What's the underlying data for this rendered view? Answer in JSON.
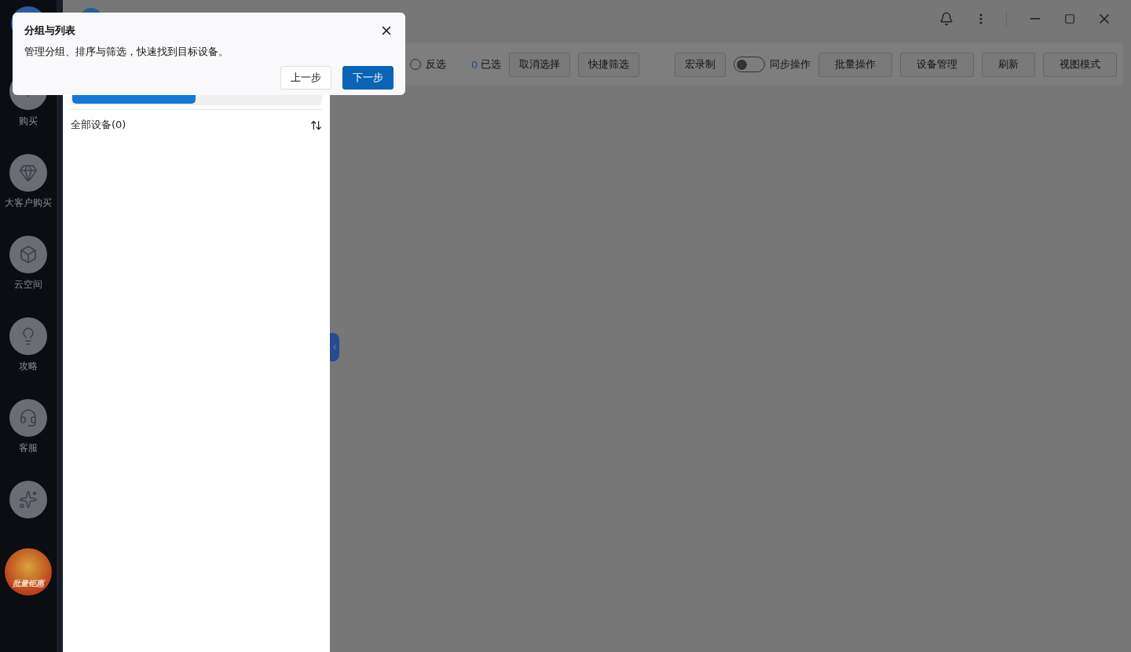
{
  "sidebar": {
    "items": [
      {
        "kind": "labeled",
        "label": "购买"
      },
      {
        "kind": "labeled",
        "label": "大客户购买"
      },
      {
        "kind": "labeled",
        "label": "云空间"
      },
      {
        "kind": "labeled",
        "label": "攻略"
      },
      {
        "kind": "labeled",
        "label": "客服"
      },
      {
        "kind": "icon_only"
      }
    ],
    "promo": {
      "label": "批量钜惠"
    }
  },
  "guide": {
    "title": "分组与列表",
    "text": "管理分组、排序与筛选，快速找到目标设备。",
    "buttons": [
      {
        "label": "上一步",
        "primary": false
      },
      {
        "label": "下一步",
        "primary": true
      }
    ]
  },
  "group_panel": {
    "tabs": [
      {
        "selected": true
      },
      {
        "selected": false
      }
    ],
    "group": "全部设备(0)"
  },
  "toolbar": {
    "invert": {
      "label": "反选",
      "checked": false
    },
    "selected_count": "0",
    "selected_label": "已选",
    "left_buttons": [
      "取消选择",
      "快捷筛选"
    ],
    "macro": "宏录制",
    "sync": {
      "label": "同步操作",
      "on": false
    },
    "right_buttons": [
      "批量操作",
      "设备管理",
      "刷新",
      "视图模式"
    ]
  }
}
